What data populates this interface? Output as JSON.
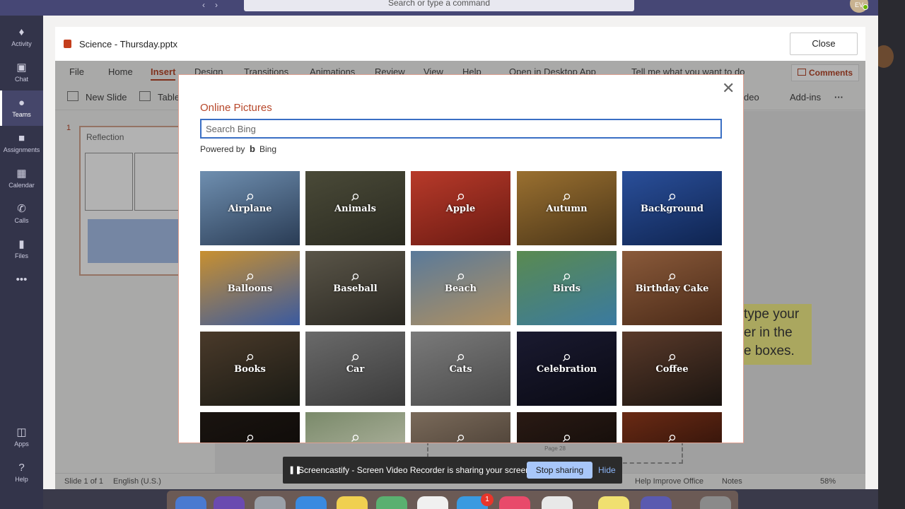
{
  "teams": {
    "search_placeholder": "Search or type a command",
    "avatar_initials": "EV",
    "rail": [
      {
        "label": "Activity",
        "icon": "bell-icon"
      },
      {
        "label": "Chat",
        "icon": "chat-icon"
      },
      {
        "label": "Teams",
        "icon": "teams-icon"
      },
      {
        "label": "Assignments",
        "icon": "assignments-icon"
      },
      {
        "label": "Calendar",
        "icon": "calendar-icon"
      },
      {
        "label": "Calls",
        "icon": "phone-icon"
      },
      {
        "label": "Files",
        "icon": "file-icon"
      },
      {
        "label": "•••",
        "icon": "more-icon"
      },
      {
        "label": "Apps",
        "icon": "apps-icon"
      },
      {
        "label": "Help",
        "icon": "help-icon"
      }
    ]
  },
  "ppt": {
    "file_title": "Science - Thursday.pptx",
    "close_label": "Close",
    "tabs": [
      "File",
      "Home",
      "Insert",
      "Design",
      "Transitions",
      "Animations",
      "Review",
      "View",
      "Help",
      "Open in Desktop App",
      "Tell me what you want to do"
    ],
    "comments_label": "Comments",
    "tools": {
      "new_slide": "New Slide",
      "table": "Table",
      "video": "deo",
      "addins": "Add-ins",
      "more": "···"
    },
    "slide_number": "1",
    "thumb_title": "Reflection",
    "yellow_note": "type your\ner in the\ne boxes.",
    "page_label": "Page 28",
    "status": {
      "slide": "Slide 1 of 1",
      "language": "English (U.S.)",
      "help": "Help Improve Office",
      "notes": "Notes",
      "zoom": "58%"
    }
  },
  "dialog": {
    "title": "Online Pictures",
    "search_placeholder": "Search Bing",
    "powered_by": "Powered by",
    "bing": "Bing",
    "tiles": [
      {
        "label": "Airplane",
        "colors": [
          "#6f8fb0",
          "#2a3c55"
        ]
      },
      {
        "label": "Animals",
        "colors": [
          "#4a4a38",
          "#2a2a20"
        ]
      },
      {
        "label": "Apple",
        "colors": [
          "#b83a2a",
          "#6a1a12"
        ]
      },
      {
        "label": "Autumn",
        "colors": [
          "#9a7030",
          "#4a3518"
        ]
      },
      {
        "label": "Background",
        "colors": [
          "#2a4f9a",
          "#0f2450"
        ]
      },
      {
        "label": "Balloons",
        "colors": [
          "#c89030",
          "#3a5aa0"
        ]
      },
      {
        "label": "Baseball",
        "colors": [
          "#5a5548",
          "#2a2822"
        ]
      },
      {
        "label": "Beach",
        "colors": [
          "#5a7a9a",
          "#b09060"
        ]
      },
      {
        "label": "Birds",
        "colors": [
          "#5a8a50",
          "#3a7aa0"
        ]
      },
      {
        "label": "Birthday Cake",
        "colors": [
          "#8a5a3a",
          "#4a2a18"
        ]
      },
      {
        "label": "Books",
        "colors": [
          "#4a3a2a",
          "#1a1a14"
        ]
      },
      {
        "label": "Car",
        "colors": [
          "#6a6a6a",
          "#3a3a3a"
        ]
      },
      {
        "label": "Cats",
        "colors": [
          "#7a7a7a",
          "#4a4a4a"
        ]
      },
      {
        "label": "Celebration",
        "colors": [
          "#1a1a30",
          "#0a0a14"
        ]
      },
      {
        "label": "Coffee",
        "colors": [
          "#5a3a2a",
          "#1a1410"
        ]
      },
      {
        "label": "",
        "colors": [
          "#1a1410",
          "#0a0806"
        ]
      },
      {
        "label": "",
        "colors": [
          "#7a8a6a",
          "#c0c0b0"
        ]
      },
      {
        "label": "",
        "colors": [
          "#7a6a5a",
          "#3a3028"
        ]
      },
      {
        "label": "",
        "colors": [
          "#2a1a14",
          "#0a0806"
        ]
      },
      {
        "label": "",
        "colors": [
          "#6a2a14",
          "#1a0a06"
        ]
      }
    ]
  },
  "screencastify": {
    "text": "Screencastify - Screen Video Recorder is sharing your screen.",
    "stop_label": "Stop sharing",
    "hide_label": "Hide"
  },
  "dock": {
    "badge_count": "1"
  }
}
